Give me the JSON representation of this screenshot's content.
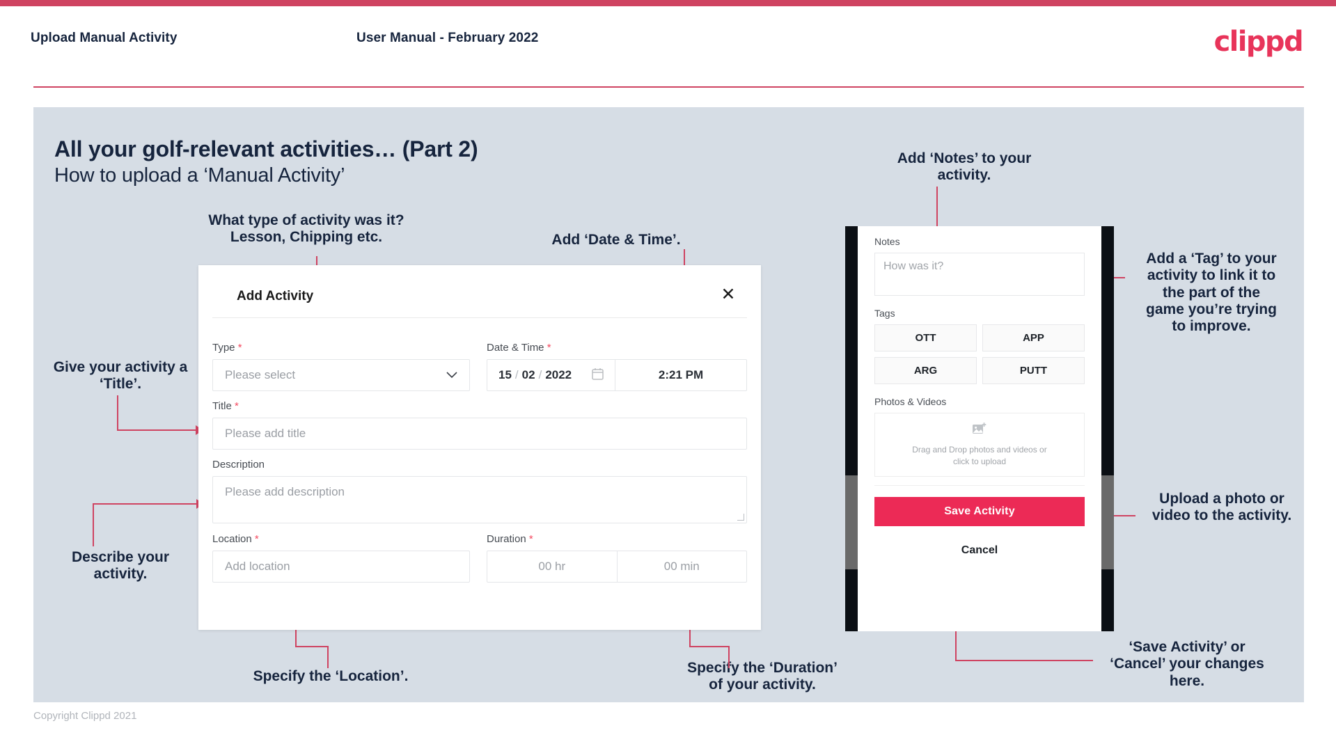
{
  "header": {
    "left_title": "Upload Manual Activity",
    "center_title": "User Manual - February 2022",
    "logo": "clippd"
  },
  "slide": {
    "title_main": "All your golf-relevant activities… (Part 2)",
    "title_sub": "How to upload a ‘Manual Activity’"
  },
  "annotations": {
    "type": "What type of activity was it?\nLesson, Chipping etc.",
    "date_time": "Add ‘Date & Time’.",
    "title": "Give your activity a\n‘Title’.",
    "description": "Describe your\nactivity.",
    "location": "Specify the ‘Location’.",
    "duration": "Specify the ‘Duration’\nof your activity.",
    "notes": "Add ‘Notes’ to your\nactivity.",
    "tags": "Add a ‘Tag’ to your\nactivity to link it to\nthe part of the\ngame you’re trying\nto improve.",
    "upload": "Upload a photo or\nvideo to the activity.",
    "save_cancel": "‘Save Activity’ or\n‘Cancel’ your changes\nhere."
  },
  "dialog": {
    "title": "Add Activity",
    "close_icon": "✕",
    "fields": {
      "type": {
        "label": "Type",
        "required": "*",
        "placeholder": "Please select",
        "chevron": "⌄"
      },
      "datetime": {
        "label": "Date & Time",
        "required": "*",
        "day": "15",
        "sep1": "/",
        "month": "02",
        "sep2": "/",
        "year": "2022",
        "time": "2:21 PM"
      },
      "title": {
        "label": "Title",
        "required": "*",
        "placeholder": "Please add title"
      },
      "description": {
        "label": "Description",
        "placeholder": "Please add description"
      },
      "location": {
        "label": "Location",
        "required": "*",
        "placeholder": "Add location"
      },
      "duration": {
        "label": "Duration",
        "required": "*",
        "hours": "00 hr",
        "minutes": "00 min"
      }
    }
  },
  "phone": {
    "notes_label": "Notes",
    "notes_placeholder": "How was it?",
    "tags_label": "Tags",
    "tags": [
      "OTT",
      "APP",
      "ARG",
      "PUTT"
    ],
    "photos_label": "Photos & Videos",
    "dropzone_text": "Drag and Drop photos and videos or\nclick to upload",
    "save_label": "Save Activity",
    "cancel_label": "Cancel"
  },
  "footer": {
    "copyright": "Copyright Clippd 2021"
  },
  "colors": {
    "accent": "#cf4361",
    "brand_pink": "#e8345a",
    "save_pink": "#ec2a56",
    "slide_bg": "#d6dde5",
    "ink": "#16243d",
    "required": "#f4485e"
  }
}
